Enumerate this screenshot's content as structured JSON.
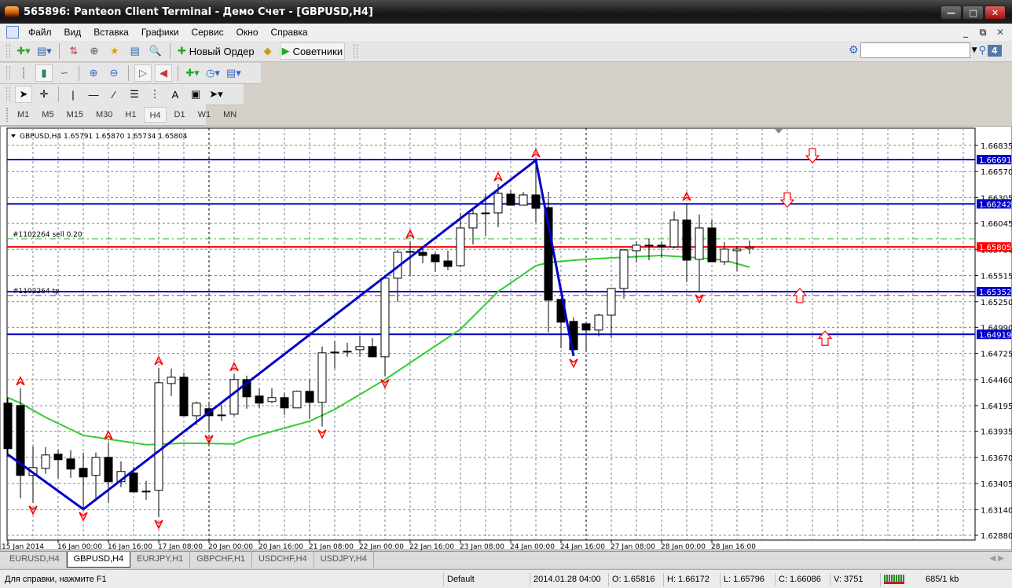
{
  "window": {
    "title": "565896: Panteon Client Terminal - Демо Счет - [GBPUSD,H4]"
  },
  "menu": [
    "Файл",
    "Вид",
    "Вставка",
    "Графики",
    "Сервис",
    "Окно",
    "Справка"
  ],
  "toolbar": {
    "new_order": "Новый Ордер",
    "experts": "Советники",
    "notifications_count": "4",
    "search_placeholder": ""
  },
  "timeframes": [
    "M1",
    "M5",
    "M15",
    "M30",
    "H1",
    "H4",
    "D1",
    "W1",
    "MN"
  ],
  "active_timeframe": "H4",
  "chart_data": {
    "type": "candlestick",
    "symbol_header": "GBPUSD,H4  1.65791 1.65870 1.65734 1.65804",
    "ylim": [
      1.6288,
      1.66835
    ],
    "y_ticks": [
      "1.66835",
      "1.66570",
      "1.66305",
      "1.66045",
      "1.65780",
      "1.65515",
      "1.65250",
      "1.64990",
      "1.64725",
      "1.64460",
      "1.64195",
      "1.63935",
      "1.63670",
      "1.63405",
      "1.63140",
      "1.62880"
    ],
    "x_labels": [
      {
        "i": 0,
        "t": "15 Jan 2014"
      },
      {
        "i": 4,
        "t": "16 Jan 00:00"
      },
      {
        "i": 8,
        "t": "16 Jan 16:00"
      },
      {
        "i": 12,
        "t": "17 Jan 08:00"
      },
      {
        "i": 16,
        "t": "20 Jan 00:00"
      },
      {
        "i": 20,
        "t": "20 Jan 16:00"
      },
      {
        "i": 24,
        "t": "21 Jan 08:00"
      },
      {
        "i": 28,
        "t": "22 Jan 00:00"
      },
      {
        "i": 32,
        "t": "22 Jan 16:00"
      },
      {
        "i": 36,
        "t": "23 Jan 08:00"
      },
      {
        "i": 40,
        "t": "24 Jan 00:00"
      },
      {
        "i": 44,
        "t": "24 Jan 16:00"
      },
      {
        "i": 48,
        "t": "27 Jan 08:00"
      },
      {
        "i": 52,
        "t": "28 Jan 00:00"
      },
      {
        "i": 56,
        "t": "28 Jan 16:00"
      }
    ],
    "candles_ohlc": [
      [
        1.64221,
        1.64277,
        1.63679,
        1.63759
      ],
      [
        1.64197,
        1.64372,
        1.63257,
        1.63488
      ],
      [
        1.63488,
        1.63783,
        1.63209,
        1.63567
      ],
      [
        1.6356,
        1.63775,
        1.63504,
        1.63695
      ],
      [
        1.63703,
        1.63751,
        1.63456,
        1.63647
      ],
      [
        1.63655,
        1.63743,
        1.63464,
        1.63552
      ],
      [
        1.6356,
        1.63719,
        1.63145,
        1.63472
      ],
      [
        1.63488,
        1.63719,
        1.63257,
        1.63671
      ],
      [
        1.63671,
        1.63823,
        1.63209,
        1.63424
      ],
      [
        1.63424,
        1.63631,
        1.63368,
        1.63528
      ],
      [
        1.63512,
        1.63575,
        1.6332,
        1.6332
      ],
      [
        1.63328,
        1.63432,
        1.63241,
        1.63328
      ],
      [
        1.63336,
        1.64579,
        1.63065,
        1.64428
      ],
      [
        1.6442,
        1.64571,
        1.64293,
        1.64484
      ],
      [
        1.64484,
        1.64532,
        1.64093,
        1.64093
      ],
      [
        1.64093,
        1.64237,
        1.63998,
        1.64221
      ],
      [
        1.64165,
        1.64221,
        1.63926,
        1.64093
      ],
      [
        1.64101,
        1.64205,
        1.64038,
        1.64101
      ],
      [
        1.64109,
        1.64516,
        1.64093,
        1.6446
      ],
      [
        1.6446,
        1.645,
        1.64165,
        1.64285
      ],
      [
        1.64293,
        1.64372,
        1.64173,
        1.64221
      ],
      [
        1.64237,
        1.64372,
        1.64221,
        1.64277
      ],
      [
        1.64277,
        1.64325,
        1.64101,
        1.64173
      ],
      [
        1.64173,
        1.64349,
        1.64173,
        1.64341
      ],
      [
        1.64341,
        1.6446,
        1.64062,
        1.64229
      ],
      [
        1.64229,
        1.64795,
        1.63982,
        1.64731
      ],
      [
        1.64731,
        1.6485,
        1.64571,
        1.64739
      ],
      [
        1.64747,
        1.64834,
        1.64691,
        1.64747
      ],
      [
        1.64763,
        1.64898,
        1.64691,
        1.64795
      ],
      [
        1.64795,
        1.64882,
        1.64691,
        1.64691
      ],
      [
        1.64691,
        1.65488,
        1.64492,
        1.65488
      ],
      [
        1.65488,
        1.65775,
        1.65249,
        1.65751
      ],
      [
        1.65759,
        1.65863,
        1.65512,
        1.65759
      ],
      [
        1.65751,
        1.65807,
        1.65639,
        1.65719
      ],
      [
        1.65727,
        1.65751,
        1.65552,
        1.65655
      ],
      [
        1.65663,
        1.65767,
        1.65568,
        1.65607
      ],
      [
        1.65615,
        1.6615,
        1.656,
        1.65998
      ],
      [
        1.65998,
        1.66189,
        1.65831,
        1.66142
      ],
      [
        1.6615,
        1.66349,
        1.65918,
        1.6615
      ],
      [
        1.6615,
        1.66444,
        1.66006,
        1.66349
      ],
      [
        1.66341,
        1.66381,
        1.66229,
        1.66229
      ],
      [
        1.66229,
        1.66365,
        1.66229,
        1.66333
      ],
      [
        1.66333,
        1.66684,
        1.66054,
        1.66197
      ],
      [
        1.66205,
        1.66365,
        1.64938,
        1.65265
      ],
      [
        1.65273,
        1.65273,
        1.64779,
        1.65042
      ],
      [
        1.6505,
        1.6509,
        1.64699,
        1.64763
      ],
      [
        1.65026,
        1.65026,
        1.64739,
        1.64962
      ],
      [
        1.64962,
        1.65129,
        1.64898,
        1.65113
      ],
      [
        1.65113,
        1.65392,
        1.64882,
        1.65384
      ],
      [
        1.65384,
        1.65783,
        1.65281,
        1.65775
      ],
      [
        1.65767,
        1.65863,
        1.65647,
        1.65823
      ],
      [
        1.65823,
        1.65887,
        1.65671,
        1.65823
      ],
      [
        1.65823,
        1.65863,
        1.65695,
        1.65807
      ],
      [
        1.65807,
        1.66165,
        1.65791,
        1.66078
      ],
      [
        1.66078,
        1.66245,
        1.65448,
        1.65671
      ],
      [
        1.65679,
        1.66134,
        1.65353,
        1.65998
      ],
      [
        1.65998,
        1.66078,
        1.65655,
        1.65655
      ],
      [
        1.65655,
        1.65855,
        1.65623,
        1.65783
      ],
      [
        1.65767,
        1.65815,
        1.6556,
        1.65783
      ],
      [
        1.65791,
        1.6587,
        1.65734,
        1.65804
      ]
    ],
    "moving_average": [
      [
        0,
        1.64277
      ],
      [
        1,
        1.64221
      ],
      [
        3,
        1.64077
      ],
      [
        6,
        1.63894
      ],
      [
        11,
        1.63799
      ],
      [
        14,
        1.63815
      ],
      [
        18,
        1.63807
      ],
      [
        19,
        1.63862
      ],
      [
        24,
        1.64038
      ],
      [
        26,
        1.64157
      ],
      [
        30,
        1.6446
      ],
      [
        36,
        1.6497
      ],
      [
        39,
        1.65353
      ],
      [
        42,
        1.65615
      ],
      [
        43,
        1.65647
      ],
      [
        45,
        1.65671
      ],
      [
        48,
        1.65695
      ],
      [
        52,
        1.65719
      ],
      [
        55,
        1.65695
      ],
      [
        57,
        1.65671
      ],
      [
        59,
        1.656
      ]
    ],
    "zigzag": [
      [
        0,
        1.637
      ],
      [
        6,
        1.63145
      ],
      [
        42,
        1.66684
      ],
      [
        45,
        1.64699
      ]
    ],
    "fractals_up": [
      1,
      8,
      12,
      18,
      32,
      39,
      42,
      54
    ],
    "fractals_down": [
      2,
      6,
      12,
      16,
      25,
      30,
      45,
      55
    ],
    "levels": [
      {
        "price": 1.66691,
        "label": "1.66691",
        "color": "#0000c8"
      },
      {
        "price": 1.66242,
        "label": "1.66242",
        "color": "#0000c8"
      },
      {
        "price": 1.65352,
        "label": "1.65352",
        "color": "#0000c8"
      },
      {
        "price": 1.64919,
        "label": "1.64919",
        "color": "#0000c8"
      },
      {
        "price": 1.65805,
        "label": "1.65805",
        "color": "#ff0000"
      }
    ],
    "trade_lines": [
      {
        "price": 1.65887,
        "text": "#1102264 sell 0.20",
        "color": "#33bb33"
      },
      {
        "price": 1.65313,
        "text": "#1102264 tp",
        "color": "#ff0000"
      }
    ],
    "signal_arrows": [
      {
        "i": 64,
        "price": 1.66691,
        "dir": "down"
      },
      {
        "i": 62,
        "price": 1.66242,
        "dir": "down"
      },
      {
        "i": 63,
        "price": 1.65352,
        "dir": "up"
      },
      {
        "i": 65,
        "price": 1.64919,
        "dir": "up"
      }
    ],
    "period_separators": [
      16,
      46
    ]
  },
  "tabs": [
    "EURUSD,H4",
    "GBPUSD,H4",
    "EURJPY,H1",
    "GBPCHF,H1",
    "USDCHF,H4",
    "USDJPY,H4"
  ],
  "active_tab": "GBPUSD,H4",
  "status": {
    "help": "Для справки, нажмите F1",
    "profile": "Default",
    "time": "2014.01.28 04:00",
    "open": "O: 1.65816",
    "high": "H: 1.66172",
    "low": "L: 1.65796",
    "close": "C: 1.66086",
    "volume": "V: 3751",
    "traffic": "685/1 kb"
  }
}
